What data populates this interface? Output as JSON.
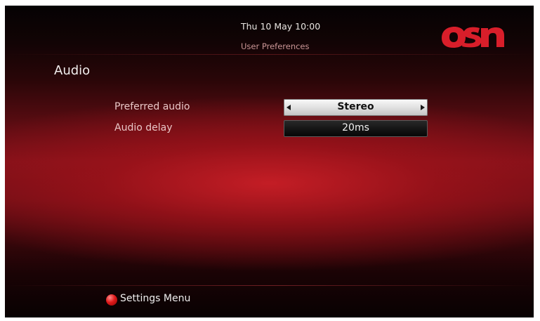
{
  "header": {
    "datetime": "Thu 10 May 10:00",
    "subtitle": "User Preferences",
    "logo": {
      "text": "osn",
      "icon": "osn-logo",
      "color": "#d81e2a"
    }
  },
  "page": {
    "title": "Audio"
  },
  "settings": {
    "preferred_audio": {
      "label": "Preferred audio",
      "value": "Stereo"
    },
    "audio_delay": {
      "label": "Audio delay",
      "value": "20ms"
    }
  },
  "footer": {
    "red_button": {
      "icon": "red-button-icon",
      "color": "#e01a1a"
    },
    "label": "Settings Menu"
  },
  "colors": {
    "background_red": "#8e121b",
    "background_dark": "#050203",
    "selected_field": "#e6e6e6",
    "unselected_field": "#141414"
  }
}
